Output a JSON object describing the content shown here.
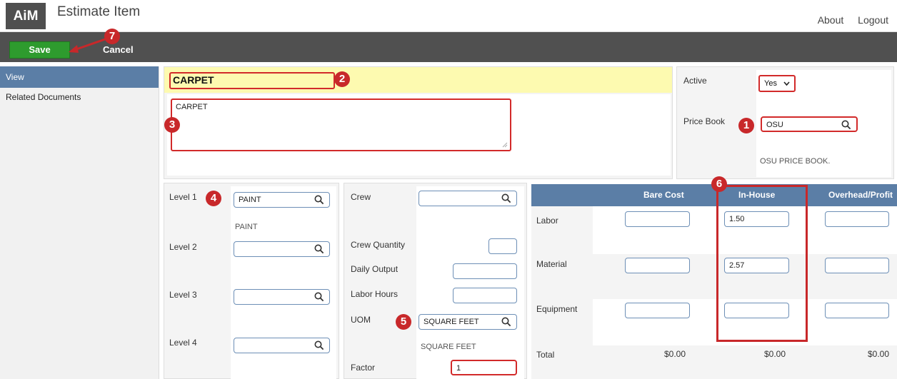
{
  "header": {
    "logo": "AiM",
    "title": "Estimate Item",
    "nav": [
      "About",
      "Logout"
    ]
  },
  "toolbar": {
    "save_label": "Save",
    "cancel_label": "Cancel"
  },
  "sidebar": {
    "items": [
      {
        "label": "View",
        "active": true
      },
      {
        "label": "Related Documents",
        "active": false
      }
    ]
  },
  "item": {
    "name": "CARPET",
    "description": "CARPET"
  },
  "status": {
    "active_label": "Active",
    "active_value": "Yes",
    "price_book_label": "Price Book",
    "price_book_value": "OSU",
    "price_book_desc": "OSU PRICE BOOK."
  },
  "levels": {
    "level1_label": "Level 1",
    "level1_value": "PAINT",
    "level1_desc": "PAINT",
    "level2_label": "Level 2",
    "level2_value": "",
    "level3_label": "Level 3",
    "level3_value": "",
    "level4_label": "Level 4",
    "level4_value": ""
  },
  "crew": {
    "crew_label": "Crew",
    "crew_value": "",
    "crew_quantity_label": "Crew Quantity",
    "crew_quantity_value": "",
    "daily_output_label": "Daily Output",
    "daily_output_value": "",
    "labor_hours_label": "Labor Hours",
    "labor_hours_value": "",
    "uom_label": "UOM",
    "uom_value": "SQUARE FEET",
    "uom_desc": "SQUARE FEET",
    "factor_label": "Factor",
    "factor_value": "1"
  },
  "costs": {
    "columns": [
      "Bare Cost",
      "In-House",
      "Overhead/Profit"
    ],
    "rows": [
      {
        "label": "Labor",
        "bare": "",
        "in_house": "1.50",
        "overhead": ""
      },
      {
        "label": "Material",
        "bare": "",
        "in_house": "2.57",
        "overhead": ""
      },
      {
        "label": "Equipment",
        "bare": "",
        "in_house": "",
        "overhead": ""
      }
    ],
    "total_label": "Total",
    "totals": [
      "$0.00",
      "$0.00",
      "$0.00"
    ]
  },
  "callouts": [
    "1",
    "2",
    "3",
    "4",
    "5",
    "6",
    "7"
  ],
  "colors": {
    "callout_red": "#c8282a",
    "save_green": "#2e9b2e",
    "header_blue": "#5b7ea6",
    "name_highlight": "#fdfab0"
  }
}
